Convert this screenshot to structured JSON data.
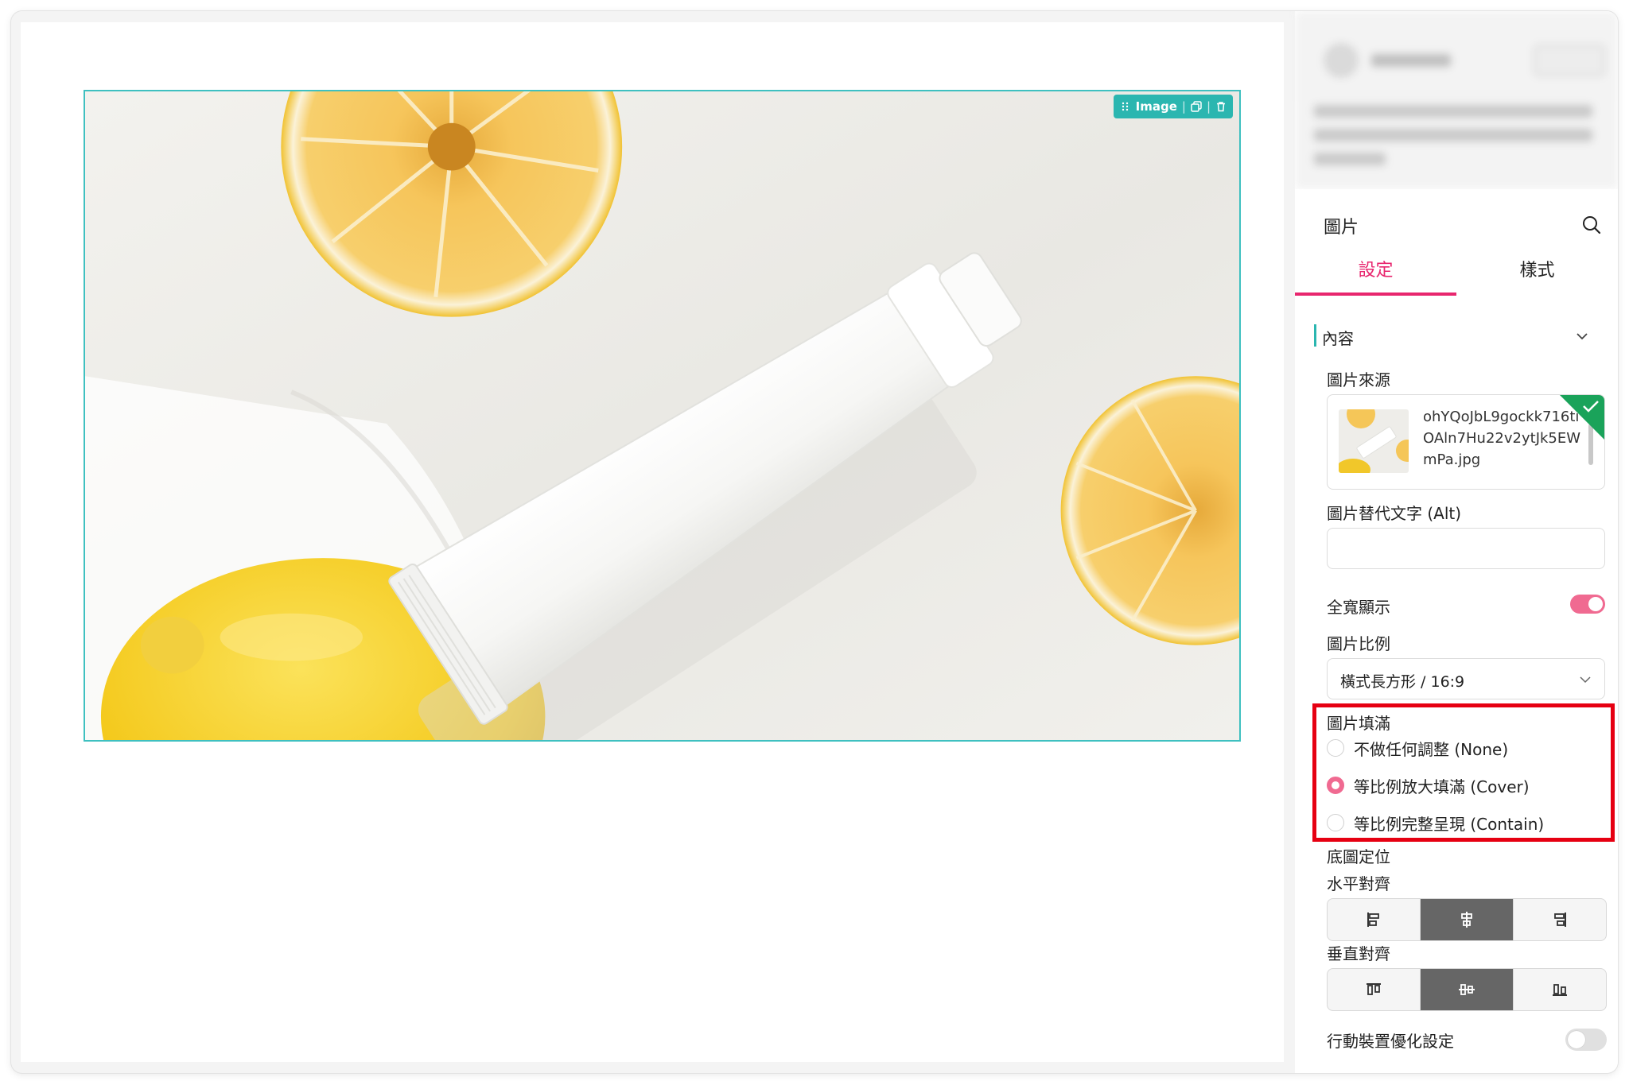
{
  "canvas": {
    "image_toolbar": {
      "label": "Image",
      "sep": "|"
    }
  },
  "panel": {
    "title": "圖片",
    "tabs": [
      {
        "label": "設定",
        "active": true
      },
      {
        "label": "樣式",
        "active": false
      }
    ],
    "section": {
      "label": "內容"
    },
    "image_source": {
      "label": "圖片來源",
      "file_name": "ohYQoJbL9gockk716tiOAln7Hu22v2ytJk5EWmPa.jpg"
    },
    "alt_text": {
      "label": "圖片替代文字 (Alt)",
      "value": ""
    },
    "full_width": {
      "label": "全寬顯示",
      "enabled": true
    },
    "aspect_ratio": {
      "label": "圖片比例",
      "selected": "橫式長方形 / 16:9"
    },
    "image_fill": {
      "label": "圖片填滿",
      "options": [
        {
          "label": "不做任何調整 (None)",
          "checked": false
        },
        {
          "label": "等比例放大填滿 (Cover)",
          "checked": true
        },
        {
          "label": "等比例完整呈現 (Contain)",
          "checked": false
        }
      ]
    },
    "bg_position": {
      "label": "底圖定位"
    },
    "horizontal_align": {
      "label": "水平對齊",
      "active_index": 1,
      "icons": [
        "align-left-icon",
        "align-center-icon",
        "align-right-icon"
      ]
    },
    "vertical_align": {
      "label": "垂直對齊",
      "active_index": 1,
      "icons": [
        "align-top-icon",
        "align-middle-icon",
        "align-bottom-icon"
      ]
    },
    "mobile_optimize": {
      "label": "行動裝置優化設定",
      "enabled": false
    }
  },
  "colors": {
    "accent_pink": "#e8266e",
    "toggle_pink": "#f06a91",
    "teal": "#2bb6b0",
    "highlight_red": "#e60012",
    "segment_active": "#666666"
  }
}
